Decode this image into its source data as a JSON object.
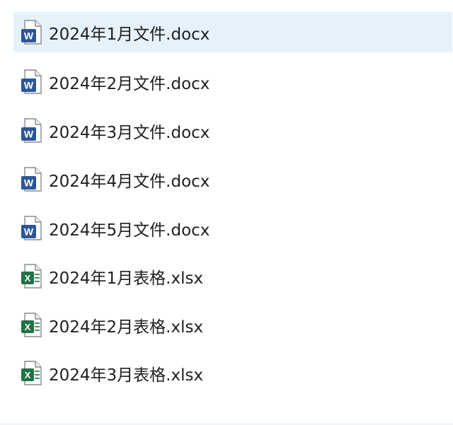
{
  "file_list": {
    "items": [
      {
        "name": "2024年1月文件.docx",
        "type": "word",
        "icon": "word-document-icon",
        "selected": true
      },
      {
        "name": "2024年2月文件.docx",
        "type": "word",
        "icon": "word-document-icon",
        "selected": false
      },
      {
        "name": "2024年3月文件.docx",
        "type": "word",
        "icon": "word-document-icon",
        "selected": false
      },
      {
        "name": "2024年4月文件.docx",
        "type": "word",
        "icon": "word-document-icon",
        "selected": false
      },
      {
        "name": "2024年5月文件.docx",
        "type": "word",
        "icon": "word-document-icon",
        "selected": false
      },
      {
        "name": "2024年1月表格.xlsx",
        "type": "excel",
        "icon": "excel-spreadsheet-icon",
        "selected": false
      },
      {
        "name": "2024年2月表格.xlsx",
        "type": "excel",
        "icon": "excel-spreadsheet-icon",
        "selected": false
      },
      {
        "name": "2024年3月表格.xlsx",
        "type": "excel",
        "icon": "excel-spreadsheet-icon",
        "selected": false
      }
    ]
  },
  "colors": {
    "selection_background": "#e5f1fb",
    "word_blue": "#2b579a",
    "excel_green": "#217346"
  }
}
